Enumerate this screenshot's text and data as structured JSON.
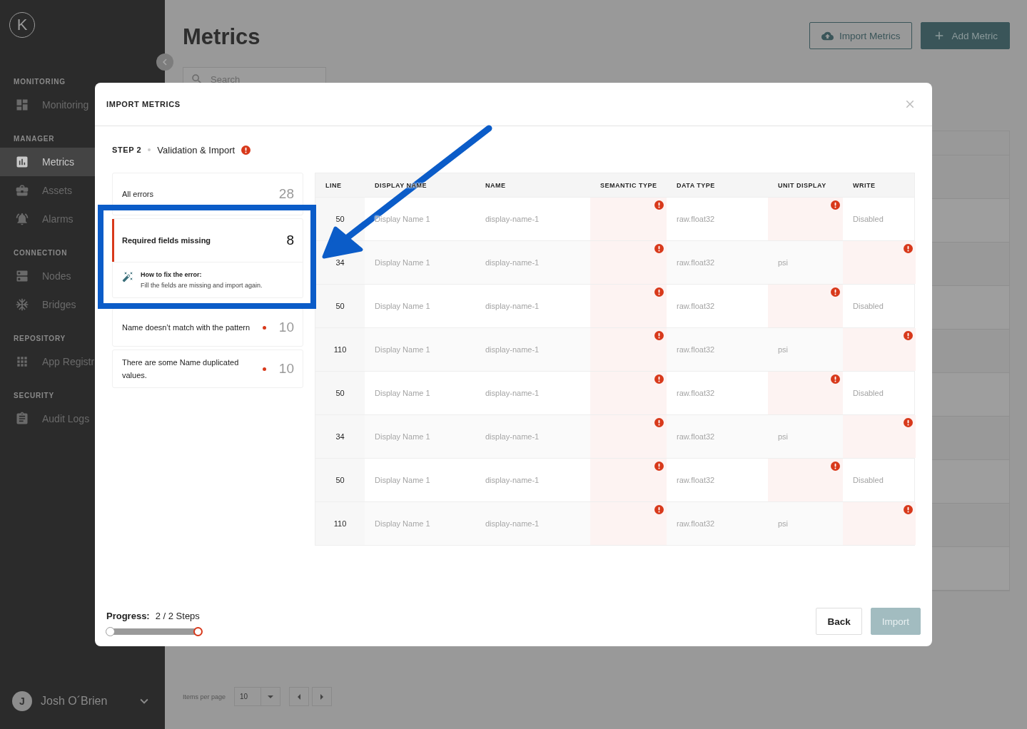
{
  "sidebar": {
    "logo": "K",
    "sections": [
      {
        "title": "MONITORING",
        "items": [
          {
            "label": "Monitoring",
            "selected": false
          }
        ]
      },
      {
        "title": "MANAGER",
        "items": [
          {
            "label": "Metrics",
            "selected": true
          },
          {
            "label": "Assets",
            "selected": false
          },
          {
            "label": "Alarms",
            "selected": false
          }
        ]
      },
      {
        "title": "CONNECTION",
        "items": [
          {
            "label": "Nodes",
            "selected": false
          },
          {
            "label": "Bridges",
            "selected": false
          }
        ]
      },
      {
        "title": "REPOSITORY",
        "items": [
          {
            "label": "App Registr",
            "selected": false
          }
        ]
      },
      {
        "title": "SECURITY",
        "items": [
          {
            "label": "Audit Logs",
            "selected": false
          }
        ]
      }
    ],
    "user": {
      "initial": "J",
      "name": "Josh O´Brien"
    }
  },
  "page": {
    "title": "Metrics",
    "buttons": [
      {
        "label": "Import Metrics",
        "kind": "outline"
      },
      {
        "label": "Add Metric",
        "kind": "primary"
      }
    ],
    "search": {
      "placeholder": "Search"
    },
    "pagination": {
      "label": "Items per page",
      "page_size": "10"
    }
  },
  "modal": {
    "title": "IMPORT METRICS",
    "step": {
      "label": "STEP 2",
      "name": "Validation & Import",
      "error": true
    },
    "errors": [
      {
        "kind": "total",
        "label": "All errors",
        "count": "28",
        "selected": false
      },
      {
        "kind": "error",
        "label": "Required fields missing",
        "count": "8",
        "selected": true,
        "hint": {
          "title": "How to fix the error:",
          "text": "Fill the fields are missing and import again."
        }
      },
      {
        "kind": "error",
        "label": "Name doesn’t match with the pattern",
        "count": "10",
        "selected": false
      },
      {
        "kind": "error",
        "label": "There are some Name duplicated values.",
        "count": "10",
        "selected": false
      }
    ],
    "table": {
      "columns": [
        "LINE",
        "DISPLAY NAME",
        "NAME",
        "SEMANTIC TYPE",
        "DATA TYPE",
        "UNIT DISPLAY",
        "WRITE"
      ],
      "rows": [
        {
          "cells": [
            {
              "text": "50",
              "error": false
            },
            {
              "text": "Display Name 1",
              "error": false
            },
            {
              "text": "display-name-1",
              "error": false
            },
            {
              "error": true
            },
            {
              "text": "raw.float32",
              "error": false
            },
            {
              "error": true
            },
            {
              "text": "Disabled",
              "error": false
            }
          ]
        },
        {
          "cells": [
            {
              "text": "34",
              "error": false
            },
            {
              "text": "Display Name 1",
              "error": false
            },
            {
              "text": "display-name-1",
              "error": false
            },
            {
              "error": true
            },
            {
              "text": "raw.float32",
              "error": false
            },
            {
              "text": "psi",
              "error": false
            },
            {
              "error": true
            }
          ]
        },
        {
          "cells": [
            {
              "text": "50",
              "error": false
            },
            {
              "text": "Display Name 1",
              "error": false
            },
            {
              "text": "display-name-1",
              "error": false
            },
            {
              "error": true
            },
            {
              "text": "raw.float32",
              "error": false
            },
            {
              "error": true
            },
            {
              "text": "Disabled",
              "error": false
            }
          ]
        },
        {
          "cells": [
            {
              "text": "110",
              "error": false
            },
            {
              "text": "Display Name 1",
              "error": false
            },
            {
              "text": "display-name-1",
              "error": false
            },
            {
              "error": true
            },
            {
              "text": "raw.float32",
              "error": false
            },
            {
              "text": "psi",
              "error": false
            },
            {
              "error": true
            }
          ]
        },
        {
          "cells": [
            {
              "text": "50",
              "error": false
            },
            {
              "text": "Display Name 1",
              "error": false
            },
            {
              "text": "display-name-1",
              "error": false
            },
            {
              "error": true
            },
            {
              "text": "raw.float32",
              "error": false
            },
            {
              "error": true
            },
            {
              "text": "Disabled",
              "error": false
            }
          ]
        },
        {
          "cells": [
            {
              "text": "34",
              "error": false
            },
            {
              "text": "Display Name 1",
              "error": false
            },
            {
              "text": "display-name-1",
              "error": false
            },
            {
              "error": true
            },
            {
              "text": "raw.float32",
              "error": false
            },
            {
              "text": "psi",
              "error": false
            },
            {
              "error": true
            }
          ]
        },
        {
          "cells": [
            {
              "text": "50",
              "error": false
            },
            {
              "text": "Display Name 1",
              "error": false
            },
            {
              "text": "display-name-1",
              "error": false
            },
            {
              "error": true
            },
            {
              "text": "raw.float32",
              "error": false
            },
            {
              "error": true
            },
            {
              "text": "Disabled",
              "error": false
            }
          ]
        },
        {
          "cells": [
            {
              "text": "110",
              "error": false
            },
            {
              "text": "Display Name 1",
              "error": false
            },
            {
              "text": "display-name-1",
              "error": false
            },
            {
              "error": true
            },
            {
              "text": "raw.float32",
              "error": false
            },
            {
              "text": "psi",
              "error": false
            },
            {
              "error": true
            }
          ]
        }
      ]
    },
    "progress": {
      "label": "Progress:",
      "value": "2 / 2 Steps",
      "level": 1
    },
    "buttons": [
      {
        "label": "Back",
        "kind": "secondary",
        "disabled": false
      },
      {
        "label": "Import",
        "kind": "primary",
        "disabled": true
      }
    ]
  }
}
